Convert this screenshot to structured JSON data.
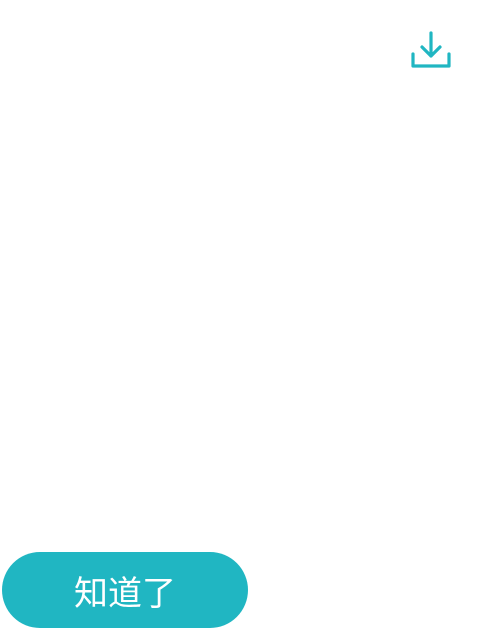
{
  "colors": {
    "accent": "#20b6c2",
    "background": "#ffffff",
    "button_text": "#ffffff"
  },
  "toolbar": {
    "download_icon": "download-icon"
  },
  "footer": {
    "ok_label": "知道了"
  }
}
